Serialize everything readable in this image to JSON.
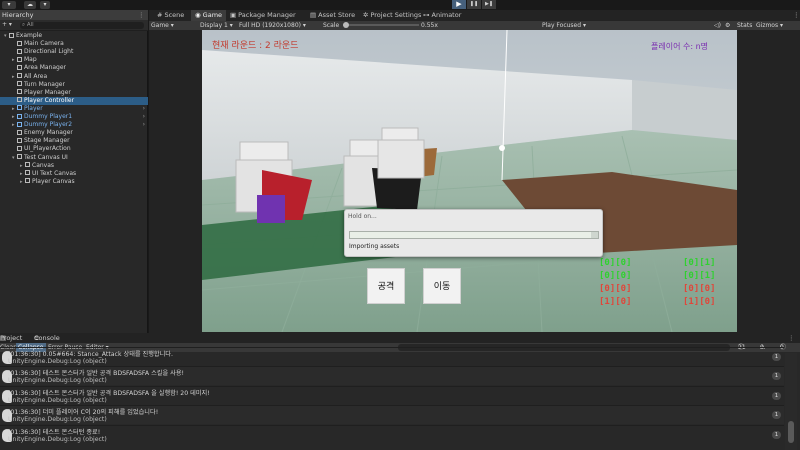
{
  "toolbar": {
    "account_label": "▾",
    "cloud_label": "☁",
    "dropdown_label": "▾"
  },
  "play_controls": {
    "play": "▶",
    "pause": "❚❚",
    "step": "▶❚"
  },
  "hierarchy": {
    "tab_label": "Hierarchy",
    "add_label": "+ ▾",
    "search_label": "⌕ All",
    "items": [
      {
        "label": "Example",
        "arrow": "▾",
        "kind": "scene"
      },
      {
        "label": "Main Camera",
        "arrow": "",
        "kind": "normal"
      },
      {
        "label": "Directional Light",
        "arrow": "",
        "kind": "normal"
      },
      {
        "label": "Map",
        "arrow": "▸",
        "kind": "normal"
      },
      {
        "label": "Area Manager",
        "arrow": "",
        "kind": "normal"
      },
      {
        "label": "All Area",
        "arrow": "▸",
        "kind": "normal"
      },
      {
        "label": "Turn Manager",
        "arrow": "",
        "kind": "normal"
      },
      {
        "label": "Player Manager",
        "arrow": "",
        "kind": "normal"
      },
      {
        "label": "Player Controller",
        "arrow": "",
        "kind": "selected"
      },
      {
        "label": "Player",
        "arrow": "▸",
        "kind": "prefab"
      },
      {
        "label": "Dummy Player1",
        "arrow": "▸",
        "kind": "prefab"
      },
      {
        "label": "Dummy Player2",
        "arrow": "▸",
        "kind": "prefab"
      },
      {
        "label": "Enemy Manager",
        "arrow": "",
        "kind": "normal"
      },
      {
        "label": "Stage Manager",
        "arrow": "",
        "kind": "normal"
      },
      {
        "label": "UI_PlayerAction",
        "arrow": "",
        "kind": "normal"
      },
      {
        "label": "Test Canvas UI",
        "arrow": "▾",
        "kind": "normal"
      },
      {
        "label": "Canvas",
        "arrow": "▸",
        "kind": "child"
      },
      {
        "label": "UI Text Canvas",
        "arrow": "▸",
        "kind": "child"
      },
      {
        "label": "Player Canvas",
        "arrow": "▸",
        "kind": "child"
      }
    ]
  },
  "view_tabs": [
    {
      "label": "Scene",
      "icon": "#",
      "active": false
    },
    {
      "label": "Game",
      "icon": "◉",
      "active": true
    },
    {
      "label": "Package Manager",
      "icon": "▣",
      "active": false
    },
    {
      "label": "Asset Store",
      "icon": "▤",
      "active": false
    },
    {
      "label": "Project Settings",
      "icon": "✲",
      "active": false
    },
    {
      "label": "Animator",
      "icon": "⊶",
      "active": false
    }
  ],
  "game_toolbar": {
    "mode": "Game",
    "display": "Display 1",
    "resolution": "Full HD (1920x1080)",
    "scale_label": "Scale",
    "scale_value": "0.55x",
    "play_focused": "Play Focused",
    "stats": "Stats",
    "gizmos": "Gizmos"
  },
  "game_ui": {
    "round_text": "현재 라운드 : 2 라운드",
    "players_text": "플레이어 수: n명",
    "attack_button": "공격",
    "move_button": "이동",
    "grid_green_left": [
      "[0][0]",
      "[0][0]"
    ],
    "grid_red_left": [
      "[0][0]",
      "[1][0]"
    ],
    "grid_green_right": [
      "[0][1]",
      "[0][1]"
    ],
    "grid_red_right": [
      "[0][0]",
      "[1][0]"
    ]
  },
  "import_dialog": {
    "title": "Hold on...",
    "status": "Importing assets",
    "progress": 0.97
  },
  "console": {
    "tabs": [
      {
        "label": "Project",
        "icon": "▤"
      },
      {
        "label": "Console",
        "icon": "≡"
      }
    ],
    "toolbar": {
      "clear": "Clear ▾",
      "collapse": "Collapse",
      "error_pause": "Error Pause",
      "editor": "Editor ▾",
      "count_warn": "21",
      "count_info": "0",
      "count_error": "0"
    },
    "logs": [
      {
        "time": "[01:36:30]",
        "message": "[01:36:30] 0.05#664: Stance_Attack 상태를 진행합니다.",
        "source": "UnityEngine.Debug:Log (object)",
        "count": "1"
      },
      {
        "time": "[01:36:30]",
        "message": "[01:36:30] 테스트 몬스터가 일반 공격 BDSFADSFA 스킬을 사용!",
        "source": "UnityEngine.Debug:Log (object)",
        "count": "1"
      },
      {
        "time": "[01:36:30]",
        "message": "[01:36:30] 테스트 몬스터가 일반 공격 BDSFADSFA 을 실행함! 20 데미지!",
        "source": "UnityEngine.Debug:Log (object)",
        "count": "1"
      },
      {
        "time": "[01:36:30]",
        "message": "[01:36:30] 더미 플레이어 C이 20의 피해를 입었습니다!",
        "source": "UnityEngine.Debug:Log (object)",
        "count": "1"
      },
      {
        "time": "[01:36:30]",
        "message": "[01:36:30] 테스트 몬스터턴 종료!",
        "source": "UnityEngine.Debug:Log (object)",
        "count": "1"
      }
    ]
  },
  "colors": {
    "accent_blue": "#2c5d87",
    "grid_green": "#2fd12f",
    "grid_red": "#e0463a",
    "round_text": "#c23b2e",
    "players_text": "#7a2fb0"
  }
}
